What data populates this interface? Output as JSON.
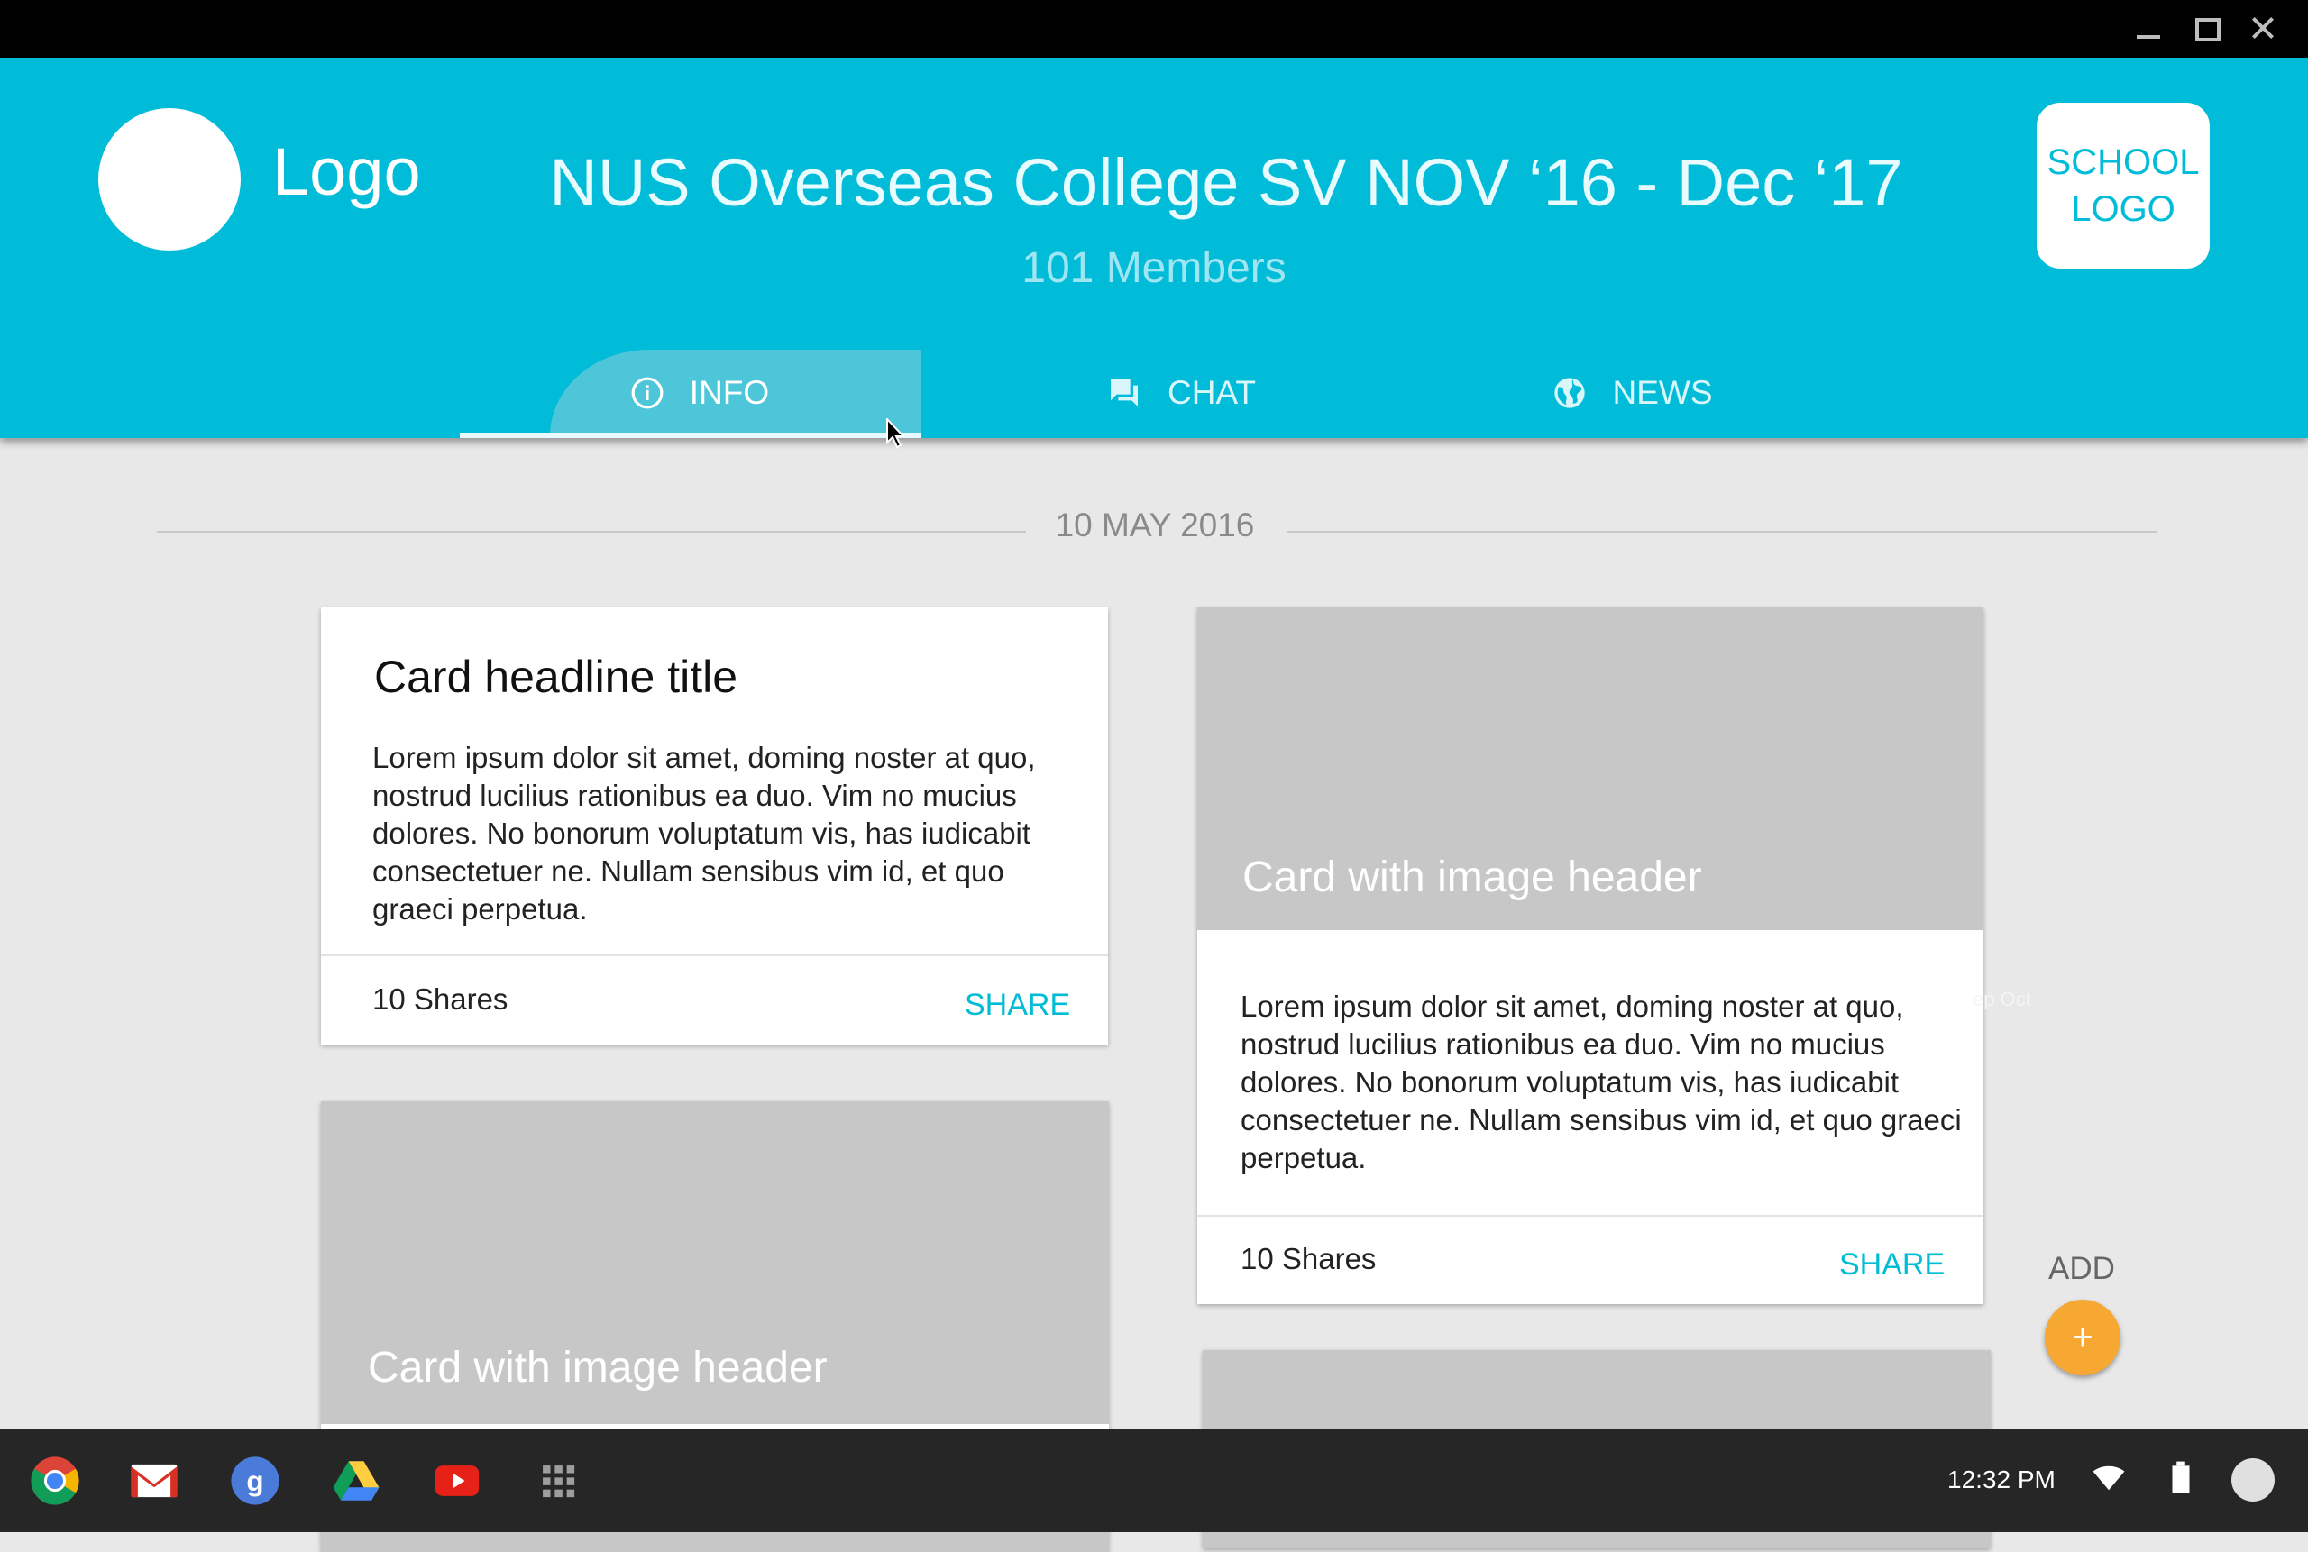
{
  "window": {
    "controls": [
      "minimize",
      "maximize",
      "close"
    ]
  },
  "header": {
    "logo_text": "Logo",
    "title": "NUS Overseas College SV NOV ‘16 - Dec ‘17",
    "members": "101 Members",
    "school_logo": "SCHOOL LOGO",
    "background": "#00bcd9"
  },
  "tabs": [
    {
      "label": "INFO",
      "icon": "info-icon",
      "active": true
    },
    {
      "label": "CHAT",
      "icon": "chat-icon",
      "active": false
    },
    {
      "label": "NEWS",
      "icon": "globe-icon",
      "active": false
    }
  ],
  "feed": {
    "date": "10 MAY 2016",
    "cards": [
      {
        "type": "text",
        "title": "Card headline title",
        "body": "Lorem ipsum dolor sit amet, doming noster at quo, nostrud lucilius rationibus ea duo. Vim no mucius dolores. No bonorum voluptatum vis, has iudicabit consectetuer ne. Nullam sensibus vim id, et quo graeci perpetua.",
        "shares": "10 Shares",
        "action": "SHARE"
      },
      {
        "type": "image",
        "image_title": "Card with image header",
        "body": "Lorem ipsum dolor sit amet, doming noster at quo, nostrud lucilius rationibus ea duo. Vim no mucius dolores. No bonorum voluptatum vis, has iudicabit consectetuer ne. Nullam sensibus vim id, et quo graeci perpetua.",
        "shares": "10 Shares",
        "action": "SHARE"
      },
      {
        "type": "image",
        "image_title": "Card with image header"
      }
    ],
    "ghost_text": "ep Oct"
  },
  "fab": {
    "label": "ADD",
    "icon": "+",
    "color": "#f7a833"
  },
  "shelf": {
    "apps": [
      "chrome-icon",
      "gmail-icon",
      "google-icon",
      "drive-icon",
      "youtube-icon",
      "app-launcher-icon"
    ],
    "time": "12:32 PM",
    "status_icons": [
      "wifi-icon",
      "battery-icon",
      "avatar"
    ]
  },
  "colors": {
    "accent": "#00bcd4",
    "background": "#e8e8e8",
    "image_placeholder": "#c7c7c7"
  }
}
